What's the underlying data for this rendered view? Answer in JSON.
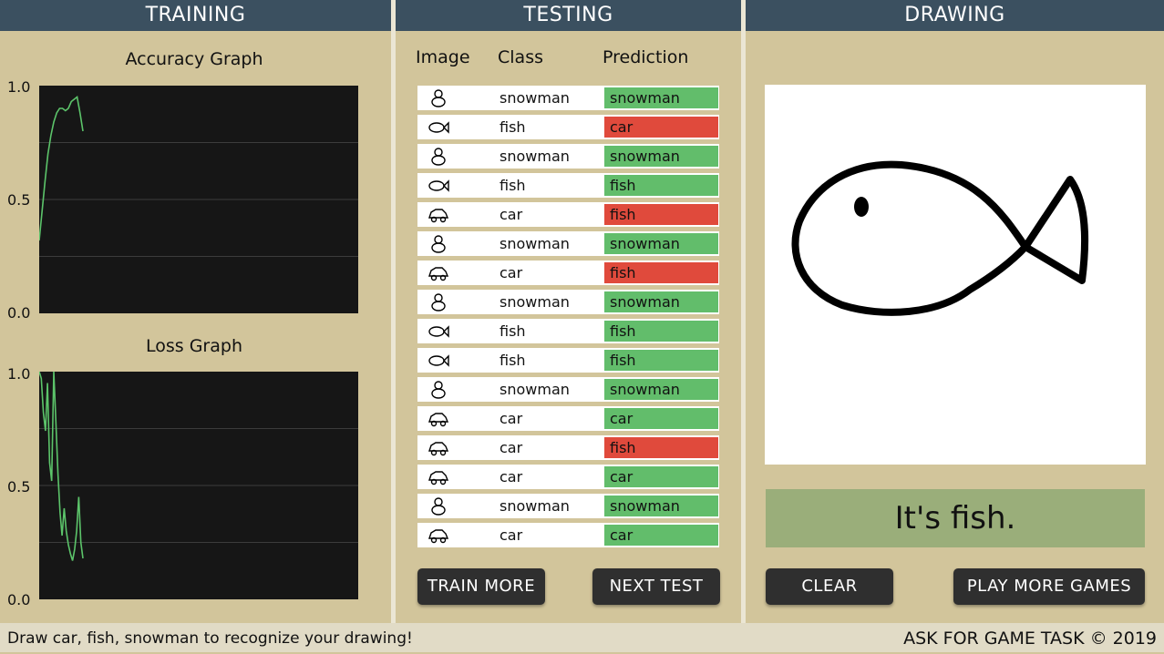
{
  "panels": {
    "training": "TRAINING",
    "testing": "TESTING",
    "drawing": "DRAWING"
  },
  "training": {
    "accuracy_title": "Accuracy Graph",
    "loss_title": "Loss Graph",
    "accuracy_ticks": [
      "1.0",
      "0.5",
      "0.0"
    ],
    "loss_ticks": [
      "1.0",
      "0.5",
      "0.0"
    ],
    "line_color": "#5cc46a"
  },
  "chart_data": [
    {
      "type": "line",
      "title": "Accuracy Graph",
      "ylim": [
        0,
        1
      ],
      "series": [
        {
          "values": [
            0.32,
            0.45,
            0.58,
            0.7,
            0.78,
            0.84,
            0.88,
            0.9,
            0.9,
            0.89,
            0.9,
            0.93,
            0.94,
            0.95,
            0.88,
            0.8
          ]
        }
      ]
    },
    {
      "type": "line",
      "title": "Loss Graph",
      "ylim": [
        0,
        1
      ],
      "series": [
        {
          "values": [
            1.0,
            0.97,
            0.82,
            0.74,
            0.95,
            0.6,
            0.52,
            1.0,
            0.78,
            0.55,
            0.38,
            0.28,
            0.4,
            0.3,
            0.24,
            0.2,
            0.17,
            0.22,
            0.3,
            0.45,
            0.25,
            0.18
          ]
        }
      ]
    }
  ],
  "testing": {
    "headers": {
      "image": "Image",
      "class": "Class",
      "prediction": "Prediction"
    },
    "rows": [
      {
        "icon": "snowman-sketch-icon",
        "cls": "snowman",
        "pred": "snowman",
        "ok": true
      },
      {
        "icon": "fish-sketch-icon",
        "cls": "fish",
        "pred": "car",
        "ok": false
      },
      {
        "icon": "snowman-sketch-icon",
        "cls": "snowman",
        "pred": "snowman",
        "ok": true
      },
      {
        "icon": "fish-sketch-icon",
        "cls": "fish",
        "pred": "fish",
        "ok": true
      },
      {
        "icon": "car-sketch-icon",
        "cls": "car",
        "pred": "fish",
        "ok": false
      },
      {
        "icon": "snowman-sketch-icon",
        "cls": "snowman",
        "pred": "snowman",
        "ok": true
      },
      {
        "icon": "car-sketch-icon",
        "cls": "car",
        "pred": "fish",
        "ok": false
      },
      {
        "icon": "snowman-sketch-icon",
        "cls": "snowman",
        "pred": "snowman",
        "ok": true
      },
      {
        "icon": "fish-sketch-icon",
        "cls": "fish",
        "pred": "fish",
        "ok": true
      },
      {
        "icon": "fish-sketch-icon",
        "cls": "fish",
        "pred": "fish",
        "ok": true
      },
      {
        "icon": "snowman-sketch-icon",
        "cls": "snowman",
        "pred": "snowman",
        "ok": true
      },
      {
        "icon": "car-sketch-icon",
        "cls": "car",
        "pred": "car",
        "ok": true
      },
      {
        "icon": "car-sketch-icon",
        "cls": "car",
        "pred": "fish",
        "ok": false
      },
      {
        "icon": "car-sketch-icon",
        "cls": "car",
        "pred": "car",
        "ok": true
      },
      {
        "icon": "snowman-sketch-icon",
        "cls": "snowman",
        "pred": "snowman",
        "ok": true
      },
      {
        "icon": "car-sketch-icon",
        "cls": "car",
        "pred": "car",
        "ok": true
      }
    ],
    "correct_color": "#62bd6b",
    "wrong_color": "#e04a3c",
    "train_more": "TRAIN MORE",
    "next_test": "NEXT TEST"
  },
  "drawing": {
    "result": "It's fish.",
    "clear": "CLEAR",
    "play_more": "PLAY MORE GAMES"
  },
  "footer": {
    "instruction": "Draw car, fish, snowman to recognize your drawing!",
    "copyright": "ASK FOR GAME TASK © 2019"
  }
}
